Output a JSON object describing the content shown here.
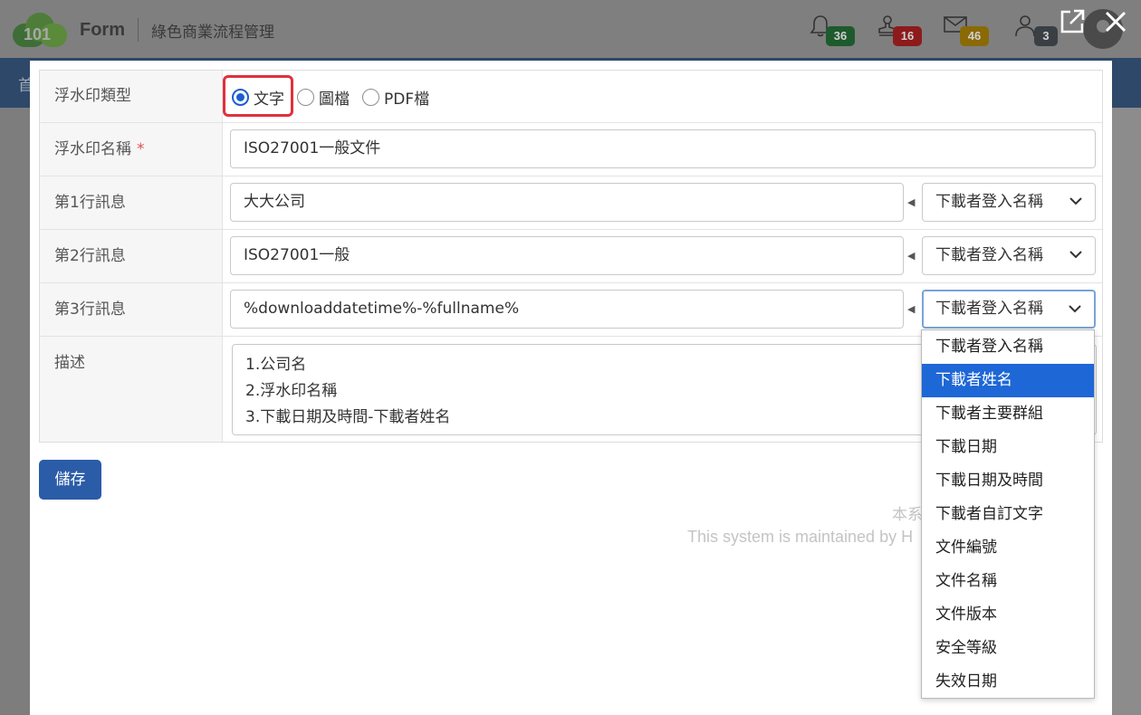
{
  "header": {
    "logo_number": "101",
    "logo_name": "Form",
    "title": "綠色商業流程管理",
    "badges": [
      {
        "icon": "bell-icon",
        "count": "36",
        "color": "#1d5a2c"
      },
      {
        "icon": "approval-icon",
        "count": "16",
        "color": "#8d1b1b"
      },
      {
        "icon": "mail-icon",
        "count": "46",
        "color": "#8a6a06"
      },
      {
        "icon": "user-icon",
        "count": "3",
        "color": "#3a3f44"
      }
    ]
  },
  "navbar": {
    "first_item": "首"
  },
  "form": {
    "type_label": "浮水印類型",
    "type_options": [
      "文字",
      "圖檔",
      "PDF檔"
    ],
    "type_selected": "文字",
    "name_label": "浮水印名稱",
    "name_required": "*",
    "name_value": "ISO27001一般文件",
    "lines": [
      {
        "label": "第1行訊息",
        "value": "大大公司",
        "select_value": "下載者登入名稱"
      },
      {
        "label": "第2行訊息",
        "value": "ISO27001一般",
        "select_value": "下載者登入名稱"
      },
      {
        "label": "第3行訊息",
        "value": "%downloaddatetime%-%fullname%",
        "select_value": "下載者登入名稱"
      }
    ],
    "desc_label": "描述",
    "desc_lines": [
      "1.公司名",
      "2.浮水印名稱",
      "3.下載日期及時間-下載者姓名"
    ],
    "save_label": "儲存"
  },
  "footer": {
    "line1": "本系",
    "line2": "This system is maintained by H"
  },
  "dropdown": {
    "options": [
      "下載者登入名稱",
      "下載者姓名",
      "下載者主要群組",
      "下載日期",
      "下載日期及時間",
      "下載者自訂文字",
      "文件編號",
      "文件名稱",
      "文件版本",
      "安全等級",
      "失效日期"
    ],
    "highlighted": "下載者姓名"
  },
  "colors": {
    "accent": "#2b5ca8",
    "highlight_border": "#e0303c",
    "selected_option": "#1e67d6"
  }
}
